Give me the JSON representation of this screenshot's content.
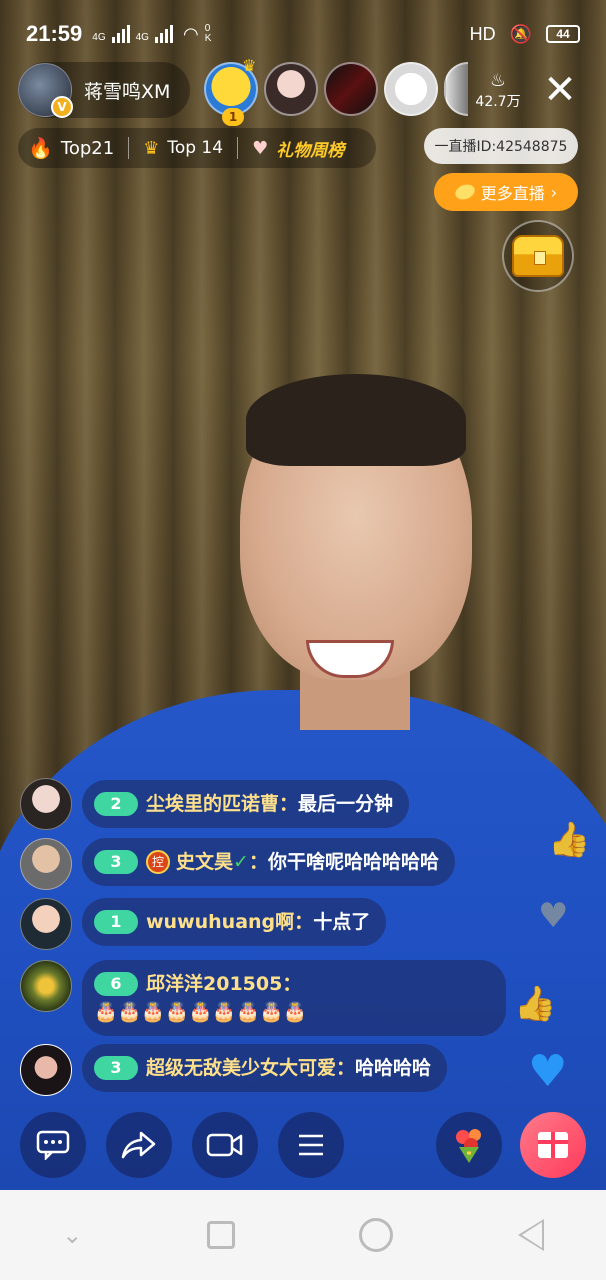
{
  "status": {
    "time": "21:59",
    "sim1": "4G",
    "sim2": "4G",
    "speed": "0 K",
    "hd": "HD",
    "battery": "44"
  },
  "host": {
    "name": "蒋雪鸣XM",
    "badge": "V"
  },
  "viewers": {
    "top_rank": "1"
  },
  "heat": {
    "value": "42.7万"
  },
  "rank_bar": {
    "top_rank": "Top21",
    "crown_rank": "Top 14",
    "gift_week": "礼物周榜"
  },
  "room_id": "一直播ID:42548875",
  "more_live": "更多直播",
  "chat": [
    {
      "level": "2",
      "user": "尘埃里的匹诺曹",
      "message": "最后一分钟"
    },
    {
      "level": "3",
      "badge": "控",
      "user": "史文昊",
      "verified": "✓",
      "message": "你干啥呢哈哈哈哈哈"
    },
    {
      "level": "1",
      "user": "wuwuhuang啊",
      "message": "十点了"
    },
    {
      "level": "6",
      "user": "邱洋洋201505",
      "message": "🎂🎂🎂🎂🎂🎂🎂🎂🎂"
    },
    {
      "level": "3",
      "user": "超级无敌美少女大可爱",
      "message": "哈哈哈哈"
    }
  ],
  "separator": "：",
  "icons": {
    "comment": "comment-icon",
    "share": "share-icon",
    "video": "video-camera-icon",
    "menu": "menu-icon",
    "bouquet": "bouquet-icon",
    "gift": "gift-icon"
  }
}
